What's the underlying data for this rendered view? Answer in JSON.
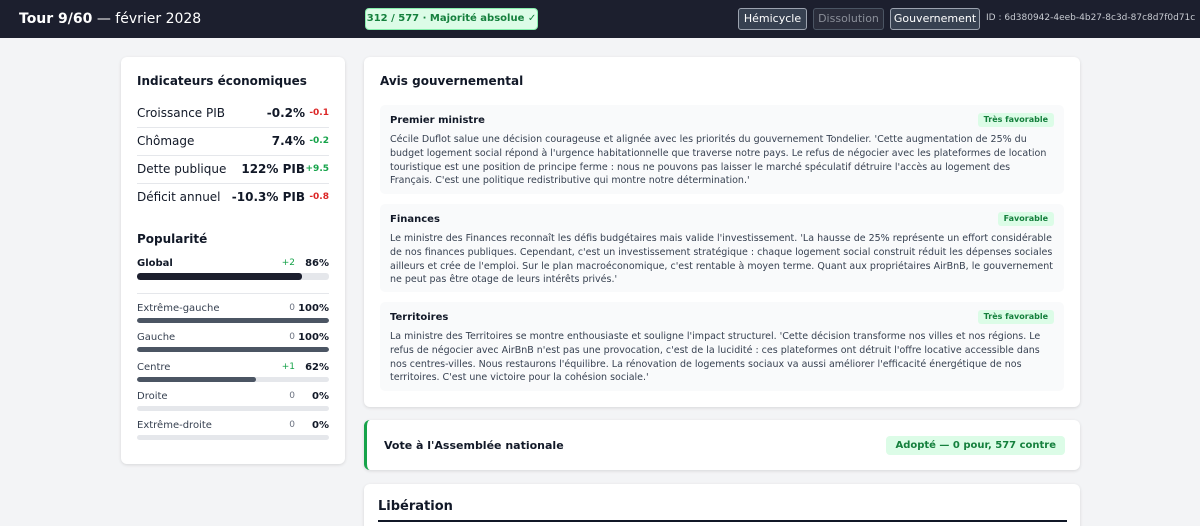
{
  "topbar": {
    "turn": "Tour 9/60",
    "date": " — février 2028",
    "majority": "312 / 577  ·  Majorité absolue  ✓",
    "buttons": {
      "hemicycle": "Hémicycle",
      "dissolution": "Dissolution",
      "gouvernement": "Gouvernement"
    },
    "id_text": "ID : 6d380942-4eeb-4b27-8c3d-87c8d7f0d71c"
  },
  "indicators": {
    "title": "Indicateurs économiques",
    "rows": [
      {
        "label": "Croissance PIB",
        "value": "-0.2%",
        "delta": "-0.1",
        "tone": "red"
      },
      {
        "label": "Chômage",
        "value": "7.4%",
        "delta": "-0.2",
        "tone": "green"
      },
      {
        "label": "Dette publique",
        "value": "122% PIB",
        "delta": "+9.5",
        "tone": "green"
      },
      {
        "label": "Déficit annuel",
        "value": "-10.3% PIB",
        "delta": "-0.8",
        "tone": "red"
      }
    ]
  },
  "popularity": {
    "title": "Popularité",
    "global": {
      "label": "Global",
      "delta": "+2",
      "value": "86%",
      "level": 0.86
    },
    "groups": [
      {
        "label": "Extrême-gauche",
        "delta": "0",
        "value": "100%",
        "level": 1.0
      },
      {
        "label": "Gauche",
        "delta": "0",
        "value": "100%",
        "level": 1.0
      },
      {
        "label": "Centre",
        "delta": "+1",
        "value": "62%",
        "level": 0.62
      },
      {
        "label": "Droite",
        "delta": "0",
        "value": "0%",
        "level": 0
      },
      {
        "label": "Extrême-droite",
        "delta": "0",
        "value": "0%",
        "level": 0
      }
    ]
  },
  "avis": {
    "title": "Avis gouvernemental",
    "opinions": [
      {
        "title": "Premier ministre",
        "badge": "Très favorable",
        "text": "Cécile Duflot salue une décision courageuse et alignée avec les priorités du gouvernement Tondelier. 'Cette augmentation de 25% du budget logement social répond à l'urgence habitationnelle que traverse notre pays. Le refus de négocier avec les plateformes de location touristique est une position de principe ferme : nous ne pouvons pas laisser le marché spéculatif détruire l'accès au logement des Français. C'est une politique redistributive qui montre notre détermination.'"
      },
      {
        "title": "Finances",
        "badge": "Favorable",
        "text": "Le ministre des Finances reconnaît les défis budgétaires mais valide l'investissement. 'La hausse de 25% représente un effort considérable de nos finances publiques. Cependant, c'est un investissement stratégique : chaque logement social construit réduit les dépenses sociales ailleurs et crée de l'emploi. Sur le plan macroéconomique, c'est rentable à moyen terme. Quant aux propriétaires AirBnB, le gouvernement ne peut pas être otage de leurs intérêts privés.'"
      },
      {
        "title": "Territoires",
        "badge": "Très favorable",
        "text": "La ministre des Territoires se montre enthousiaste et souligne l'impact structurel. 'Cette décision transforme nos villes et nos régions. Le refus de négocier avec AirBnB n'est pas une provocation, c'est de la lucidité : ces plateformes ont détruit l'offre locative accessible dans nos centres-villes. Nous restaurons l'équilibre. La rénovation de logements sociaux va aussi améliorer l'efficacité énergétique de nos territoires. C'est une victoire pour la cohésion sociale.'"
      }
    ]
  },
  "vote": {
    "title": "Vote à l'Assemblée nationale",
    "result": "Adopté — 0 pour, 577 contre"
  },
  "liberation": {
    "title": "Libération"
  }
}
